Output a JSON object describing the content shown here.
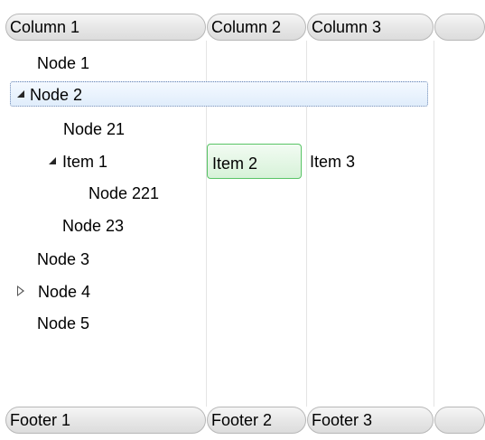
{
  "columns": [
    "Column 1",
    "Column 2",
    "Column 3",
    ""
  ],
  "footers": [
    "Footer 1",
    "Footer 2",
    "Footer 3",
    ""
  ],
  "tree": {
    "node1": "Node 1",
    "node2": "Node 2",
    "node21": "Node 21",
    "item1": {
      "col1": "Item 1",
      "col2": "Item 2",
      "col3": "Item 3"
    },
    "node221": "Node 221",
    "node23": "Node 23",
    "node3": "Node 3",
    "node4": "Node 4",
    "node5": "Node 5"
  },
  "icons": {
    "expanded": "expanded-triangle-icon",
    "collapsed": "collapsed-triangle-icon"
  },
  "colors": {
    "selection_border": "#6a86b3",
    "focus_cell_border": "#59c466"
  }
}
